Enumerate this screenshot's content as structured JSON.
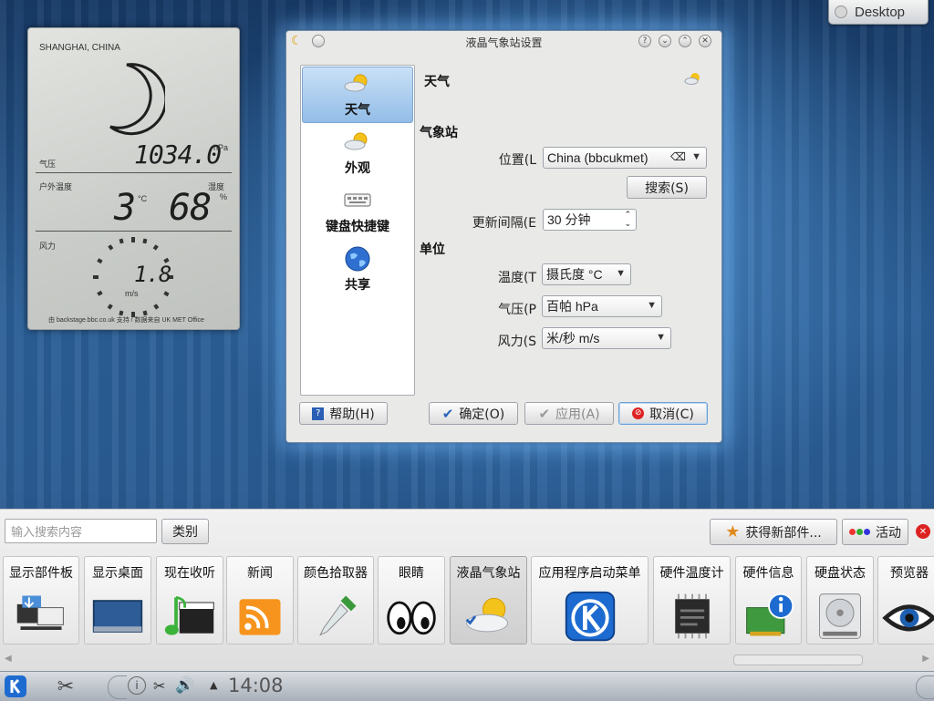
{
  "desktop_button": {
    "label": "Desktop"
  },
  "weather_widget": {
    "location": "SHANGHAI, CHINA",
    "pressure_label": "气压",
    "pressure_value": "1034.0",
    "pressure_unit": "hPa",
    "outdoor_temp_label": "户外温度",
    "humidity_label": "湿度",
    "temperature": "3",
    "temp_unit": "°C",
    "humidity": "68",
    "humidity_unit": "%",
    "wind_label": "风力",
    "wind_value": "1.8",
    "wind_unit": "m/s",
    "source": "由 backstage.bbc.co.uk 支持 / 数据来自 UK MET Office"
  },
  "dialog": {
    "title": "液晶气象站设置",
    "sidebar": [
      {
        "label": "天气",
        "icon": "weather-icon",
        "active": true
      },
      {
        "label": "外观",
        "icon": "appearance-icon",
        "active": false
      },
      {
        "label": "键盘快捷键",
        "icon": "keyboard-icon",
        "active": false
      },
      {
        "label": "共享",
        "icon": "globe-icon",
        "active": false
      }
    ],
    "page_title": "天气",
    "station_section": "气象站",
    "location_label": "位置(L",
    "location_value": "China (bbcukmet)",
    "search_button": "搜索(S)",
    "update_label": "更新间隔(E",
    "update_value": "30 分钟",
    "units_section": "单位",
    "temp_label": "温度(T",
    "temp_value": "摄氏度 °C",
    "pressure_label": "气压(P",
    "pressure_value": "百帕 hPa",
    "wind_label": "风力(S",
    "wind_value": "米/秒 m/s",
    "help_button": "帮助(H)",
    "ok_button": "确定(O)",
    "apply_button": "应用(A)",
    "cancel_button": "取消(C)"
  },
  "explorer": {
    "search_placeholder": "输入搜索内容",
    "category_button": "类别",
    "get_new_button": "获得新部件...",
    "activities_button": "活动",
    "widgets": [
      {
        "label": "显示部件板",
        "icon": "dashboard-icon"
      },
      {
        "label": "显示桌面",
        "icon": "show-desktop-icon"
      },
      {
        "label": "现在收听",
        "icon": "now-playing-icon"
      },
      {
        "label": "新闻",
        "icon": "rss-icon"
      },
      {
        "label": "颜色拾取器",
        "icon": "color-picker-icon"
      },
      {
        "label": "眼睛",
        "icon": "eyes-icon"
      },
      {
        "label": "液晶气象站",
        "icon": "weather-icon"
      },
      {
        "label": "应用程序启动菜单",
        "icon": "kde-launcher-icon"
      },
      {
        "label": "硬件温度计",
        "icon": "chip-icon"
      },
      {
        "label": "硬件信息",
        "icon": "hardware-info-icon"
      },
      {
        "label": "硬盘状态",
        "icon": "harddisk-icon"
      },
      {
        "label": "预览器",
        "icon": "previewer-icon"
      }
    ]
  },
  "taskbar": {
    "clock": "14:08"
  }
}
